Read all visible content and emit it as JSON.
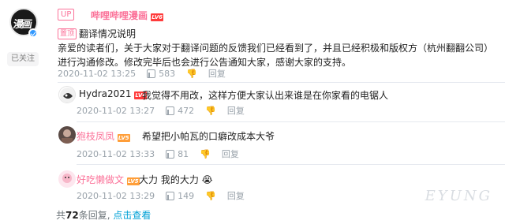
{
  "post": {
    "author": "哔哩哔哩漫画",
    "up_label": "UP",
    "level": "LV6",
    "follow_label": "已关注",
    "top_tag": "置顶",
    "title": "翻译情况说明",
    "content": "亲爱的读者们，关于大家对于翻译问题的反馈我们已经看到了，并且已经积极和版权方（杭州翻翻公司）进行沟通修改。修改完毕后也会进行公告通知大家，感谢大家的支持。",
    "time": "2020-11-02 13:25",
    "likes": "583",
    "reply_label": "回复"
  },
  "comments": [
    {
      "user": "Hydra2021",
      "level": "LV6",
      "text": "我觉得不用改，这样方便大家认出来谁是在你家看的电锯人",
      "time": "2020-11-02 13:27",
      "likes": "472",
      "reply_label": "回复"
    },
    {
      "user": "狍枝凤凤",
      "level": "LV5",
      "text": "希望把小帕瓦的口癖改成本大爷",
      "time": "2020-11-02 13:33",
      "likes": "81",
      "reply_label": "回复"
    },
    {
      "user": "好吃懒做文",
      "level": "LV5",
      "text": "大力 我的大力",
      "emoji": "😭",
      "time": "2020-11-02 13:29",
      "likes": "149",
      "reply_label": "回复"
    }
  ],
  "footer": {
    "prefix": "共",
    "count": "72",
    "suffix": "条回复,",
    "view_link": "点击查看"
  },
  "colors": {
    "brand_pink": "#fb7299",
    "link_blue": "#00a1d6",
    "meta_gray": "#99a2aa"
  }
}
